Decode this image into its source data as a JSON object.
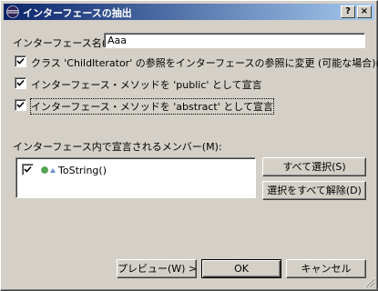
{
  "window": {
    "title": "インターフェースの抽出",
    "help_button": "?",
    "close_button": "×"
  },
  "interface_name": {
    "label": "インターフェース名(I):",
    "value": "Aaa"
  },
  "options": [
    {
      "label": "クラス 'ChildIterator' の参照をインターフェースの参照に変更 (可能な場合)(C)",
      "checked": true
    },
    {
      "label": "インターフェース・メソッドを 'public' として宣言",
      "checked": true
    },
    {
      "label": "インターフェース・メソッドを 'abstract' として宣言",
      "checked": true
    }
  ],
  "members": {
    "label": "インターフェース内で宣言されるメンバー(M):",
    "items": [
      {
        "label": "ToString()",
        "checked": true
      }
    ]
  },
  "side_buttons": {
    "select_all": "すべて選択(S)",
    "deselect_all": "選択をすべて解除(D)"
  },
  "footer_buttons": {
    "preview": "プレビュー(W) >",
    "ok": "OK",
    "cancel": "キャンセル"
  },
  "colors": {
    "title_start": "#0a246a",
    "title_end": "#a6caf0",
    "face": "#d4d0c8",
    "method_icon": "#4fa84f"
  }
}
